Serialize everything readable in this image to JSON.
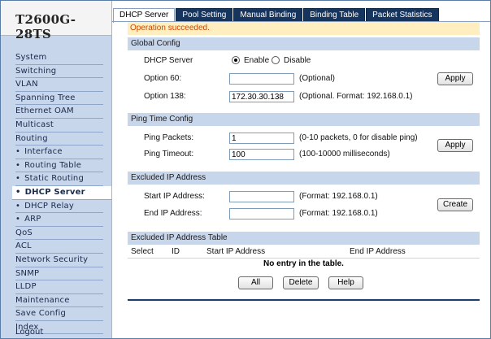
{
  "brand": "T2600G-28TS",
  "sidebar": {
    "items": [
      {
        "label": "System",
        "sub": false,
        "active": false
      },
      {
        "label": "Switching",
        "sub": false,
        "active": false
      },
      {
        "label": "VLAN",
        "sub": false,
        "active": false
      },
      {
        "label": "Spanning Tree",
        "sub": false,
        "active": false
      },
      {
        "label": "Ethernet OAM",
        "sub": false,
        "active": false
      },
      {
        "label": "Multicast",
        "sub": false,
        "active": false
      },
      {
        "label": "Routing",
        "sub": false,
        "active": false
      },
      {
        "label": "Interface",
        "sub": true,
        "active": false
      },
      {
        "label": "Routing Table",
        "sub": true,
        "active": false
      },
      {
        "label": "Static Routing",
        "sub": true,
        "active": false
      },
      {
        "label": "DHCP Server",
        "sub": true,
        "active": true
      },
      {
        "label": "DHCP Relay",
        "sub": true,
        "active": false
      },
      {
        "label": "ARP",
        "sub": true,
        "active": false
      },
      {
        "label": "QoS",
        "sub": false,
        "active": false
      },
      {
        "label": "ACL",
        "sub": false,
        "active": false
      },
      {
        "label": "Network Security",
        "sub": false,
        "active": false
      },
      {
        "label": "SNMP",
        "sub": false,
        "active": false
      },
      {
        "label": "LLDP",
        "sub": false,
        "active": false
      },
      {
        "label": "Maintenance",
        "sub": false,
        "active": false
      },
      {
        "label": "Save Config",
        "sub": false,
        "active": false
      },
      {
        "label": "Index",
        "sub": false,
        "active": false
      }
    ],
    "logout": "Logout"
  },
  "tabs": [
    {
      "label": "DHCP Server",
      "active": true
    },
    {
      "label": "Pool Setting",
      "active": false
    },
    {
      "label": "Manual Binding",
      "active": false
    },
    {
      "label": "Binding Table",
      "active": false
    },
    {
      "label": "Packet Statistics",
      "active": false
    }
  ],
  "notice": "Operation succeeded.",
  "global": {
    "title": "Global Config",
    "dhcp_label": "DHCP Server",
    "enable": "Enable",
    "disable": "Disable",
    "selected": "Enable",
    "opt60_label": "Option 60:",
    "opt60_value": "",
    "opt60_hint": "(Optional)",
    "opt138_label": "Option 138:",
    "opt138_value": "172.30.30.138",
    "opt138_hint": "(Optional. Format: 192.168.0.1)",
    "apply": "Apply"
  },
  "ping": {
    "title": "Ping Time Config",
    "packets_label": "Ping Packets:",
    "packets_value": "1",
    "packets_hint": "(0-10 packets, 0 for disable ping)",
    "timeout_label": "Ping Timeout:",
    "timeout_value": "100",
    "timeout_hint": "(100-10000 milliseconds)",
    "apply": "Apply"
  },
  "excluded": {
    "title": "Excluded IP Address",
    "start_label": "Start IP Address:",
    "start_value": "",
    "start_hint": "(Format: 192.168.0.1)",
    "end_label": "End IP Address:",
    "end_value": "",
    "end_hint": "(Format: 192.168.0.1)",
    "create": "Create"
  },
  "table": {
    "title": "Excluded IP Address Table",
    "columns": [
      "Select",
      "ID",
      "Start IP Address",
      "End IP Address"
    ],
    "empty": "No entry in the table.",
    "buttons": {
      "all": "All",
      "delete": "Delete",
      "help": "Help"
    }
  }
}
